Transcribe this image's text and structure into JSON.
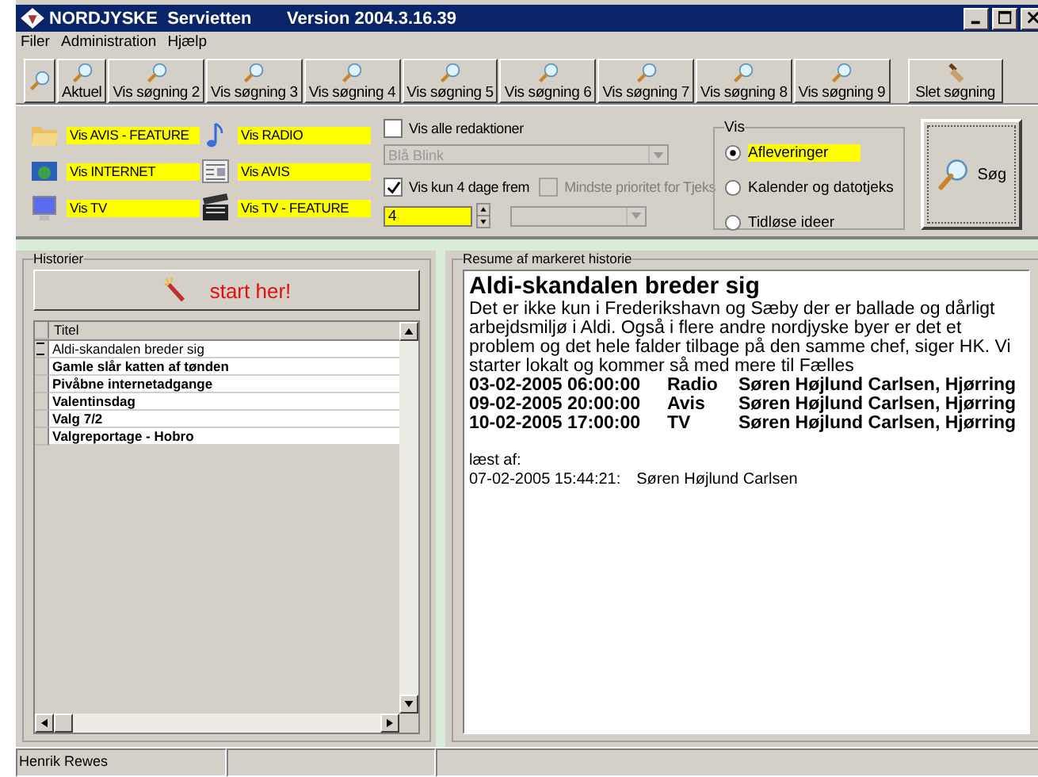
{
  "window": {
    "title": "NORDJYSKE  Servietten",
    "version": "Version 2004.3.16.39"
  },
  "menu": [
    "Filer",
    "Administration",
    "Hjælp"
  ],
  "toolbar": [
    {
      "kind": "search"
    },
    {
      "kind": "search",
      "label": "Aktuel"
    },
    {
      "kind": "search",
      "label": "Vis søgning 2"
    },
    {
      "kind": "search",
      "label": "Vis søgning 3"
    },
    {
      "kind": "search",
      "label": "Vis søgning 4"
    },
    {
      "kind": "search",
      "label": "Vis søgning 5"
    },
    {
      "kind": "search",
      "label": "Vis søgning 6"
    },
    {
      "kind": "search",
      "label": "Vis søgning 7"
    },
    {
      "kind": "search",
      "label": "Vis søgning 8"
    },
    {
      "kind": "search",
      "label": "Vis søgning 9"
    },
    {
      "kind": "delete",
      "label": "Slet søgning"
    }
  ],
  "sources": [
    {
      "kind": "folder",
      "label": "Vis AVIS - FEATURE"
    },
    {
      "kind": "note",
      "label": "Vis RADIO"
    },
    {
      "kind": "globe",
      "label": "Vis INTERNET"
    },
    {
      "kind": "newspaper",
      "label": "Vis AVIS"
    },
    {
      "kind": "monitor",
      "label": "Vis TV"
    },
    {
      "kind": "clapper",
      "label": "Vis TV - FEATURE"
    }
  ],
  "filters": {
    "all_editions": {
      "label": "Vis alle redaktioner",
      "checked": false
    },
    "edition": {
      "value": "Blå Blink",
      "disabled": true
    },
    "days_ahead": {
      "label": "Vis kun 4 dage frem",
      "checked": true
    },
    "days_value": "4",
    "min_priority": {
      "label": "Mindste prioritet for Tjeks",
      "checked": false,
      "disabled": true
    },
    "priority": {
      "disabled": true
    }
  },
  "view_group": {
    "title": "Vis",
    "options": [
      {
        "label": "Afleveringer",
        "selected": true
      },
      {
        "label": "Kalender og datotjeks",
        "selected": false
      },
      {
        "label": "Tidløse ideer",
        "selected": false
      }
    ]
  },
  "search_button": "Søg",
  "stories": {
    "title": "Historier",
    "start_button": "start her!",
    "column": "Titel",
    "rows": [
      {
        "title": "Aldi-skandalen breder sig",
        "current": true,
        "unread": false
      },
      {
        "title": "Gamle slår katten af tønden",
        "current": false,
        "unread": true
      },
      {
        "title": "Pivåbne internetadgange",
        "current": false,
        "unread": true
      },
      {
        "title": "Valentinsdag",
        "current": false,
        "unread": true
      },
      {
        "title": "Valg 7/2",
        "current": false,
        "unread": true
      },
      {
        "title": "Valgreportage - Hobro",
        "current": false,
        "unread": true
      }
    ]
  },
  "summary": {
    "title": "Resume af markeret historie",
    "headline": "Aldi-skandalen breder sig",
    "body": "Det er ikke kun i Frederikshavn og Sæby der er ballade og dårligt arbejdsmiljø i Aldi. Også i flere andre nordjyske byer er det et problem og det hele falder tilbage på den samme chef, siger HK. Vi starter lokalt og kommer så med mere til Fælles",
    "schedule": [
      {
        "time": "03-02-2005 06:00:00",
        "medium": "Radio",
        "reporter": "Søren Højlund Carlsen, Hjørring"
      },
      {
        "time": "09-02-2005 20:00:00",
        "medium": "Avis",
        "reporter": "Søren Højlund Carlsen, Hjørring"
      },
      {
        "time": "10-02-2005 17:00:00",
        "medium": "TV",
        "reporter": "Søren Højlund Carlsen, Hjørring"
      }
    ],
    "read_label": "læst af:",
    "reads": [
      {
        "time": "07-02-2005 15:44:21:",
        "name": "Søren Højlund Carlsen"
      }
    ]
  },
  "status_bar": [
    "Henrik Rewes"
  ]
}
